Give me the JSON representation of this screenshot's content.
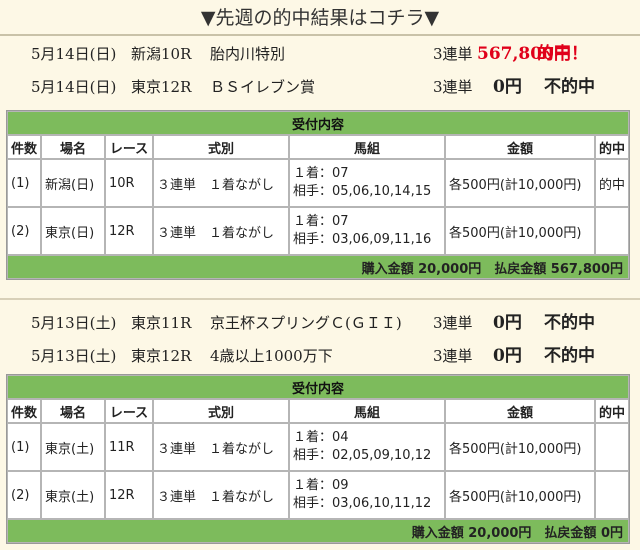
{
  "header": {
    "title": "▼先週の的中結果はコチラ▼"
  },
  "weeks": [
    {
      "summaries": [
        {
          "date": "5月14日(日)",
          "track": "新潟10R",
          "name": "胎内川特別",
          "kind": "3連単",
          "amount": "567,800円",
          "result": "的中！",
          "hit": true
        },
        {
          "date": "5月14日(日)",
          "track": "東京12R",
          "name": "ＢＳイレブン賞",
          "kind": "3連単",
          "amount": "0円",
          "result": "不的中",
          "hit": false
        }
      ],
      "table_title": "受付内容",
      "columns": [
        "件数",
        "場名",
        "レース",
        "式別",
        "馬組",
        "金額",
        "的中"
      ],
      "rows": [
        {
          "no": "(1)",
          "place": "新潟(日)",
          "race": "10R",
          "type": "３連単　１着ながし",
          "first": "１着：07",
          "partner": "相手：05,06,10,14,15",
          "amount": "各500円(計10,000円)",
          "hit": "的中"
        },
        {
          "no": "(2)",
          "place": "東京(日)",
          "race": "12R",
          "type": "３連単　１着ながし",
          "first": "１着：07",
          "partner": "相手：03,06,09,11,16",
          "amount": "各500円(計10,000円)",
          "hit": ""
        }
      ],
      "footer": "購入金額 20,000円　払戻金額 567,800円"
    },
    {
      "summaries": [
        {
          "date": "5月13日(土)",
          "track": "東京11R",
          "name": "京王杯スプリングＣ(ＧＩＩ)",
          "kind": "3連単",
          "amount": "0円",
          "result": "不的中",
          "hit": false
        },
        {
          "date": "5月13日(土)",
          "track": "東京12R",
          "name": "4歳以上1000万下",
          "kind": "3連単",
          "amount": "0円",
          "result": "不的中",
          "hit": false
        }
      ],
      "table_title": "受付内容",
      "columns": [
        "件数",
        "場名",
        "レース",
        "式別",
        "馬組",
        "金額",
        "的中"
      ],
      "rows": [
        {
          "no": "(1)",
          "place": "東京(土)",
          "race": "11R",
          "type": "３連単　１着ながし",
          "first": "１着：04",
          "partner": "相手：02,05,09,10,12",
          "amount": "各500円(計10,000円)",
          "hit": ""
        },
        {
          "no": "(2)",
          "place": "東京(土)",
          "race": "12R",
          "type": "３連単　１着ながし",
          "first": "１着：09",
          "partner": "相手：03,06,10,11,12",
          "amount": "各500円(計10,000円)",
          "hit": ""
        }
      ],
      "footer": "購入金額 20,000円　払戻金額 0円"
    }
  ]
}
